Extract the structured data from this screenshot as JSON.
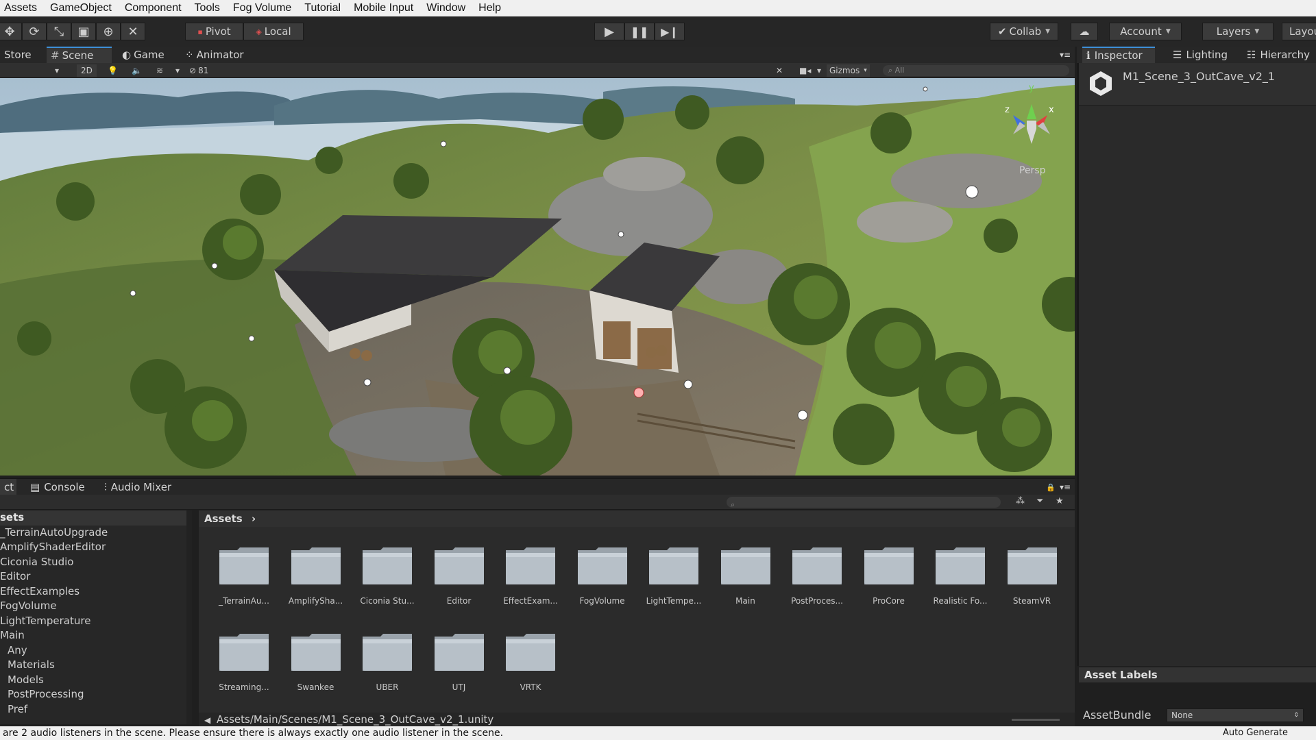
{
  "menu": [
    "Assets",
    "GameObject",
    "Component",
    "Tools",
    "Fog Volume",
    "Tutorial",
    "Mobile Input",
    "Window",
    "Help"
  ],
  "toolbar": {
    "pivot": "Pivot",
    "local": "Local",
    "collab": "Collab",
    "account": "Account",
    "layers": "Layers",
    "layout": "Layou"
  },
  "scene_tabs": {
    "store": "Store",
    "scene": "Scene",
    "game": "Game",
    "animator": "Animator"
  },
  "scene_bar": {
    "mode_2d": "2D",
    "hidden_count": "81",
    "gizmos": "Gizmos",
    "search_placeholder": "All"
  },
  "viewport": {
    "persp_label": "Persp",
    "gizmo_axes": [
      "y",
      "z",
      "x"
    ]
  },
  "inspector": {
    "tabs": [
      "Inspector",
      "Lighting",
      "Hierarchy"
    ],
    "object_name": "M1_Scene_3_OutCave_v2_1",
    "asset_labels": "Asset Labels",
    "assetbundle_label": "AssetBundle",
    "assetbundle_value": "None",
    "auto_generate": "Auto Generate Lightin"
  },
  "project": {
    "tabs": [
      "ct",
      "Console",
      "Audio Mixer"
    ],
    "tree_header": "sets",
    "tree": [
      "_TerrainAutoUpgrade",
      "AmplifyShaderEditor",
      "Ciconia Studio",
      "Editor",
      "EffectExamples",
      "FogVolume",
      "LightTemperature",
      "Main",
      "Any",
      "Materials",
      "Models",
      "PostProcessing",
      "Pref"
    ],
    "grid_header": "Assets",
    "folders": [
      "_TerrainAu...",
      "AmplifySha...",
      "Ciconia Stu...",
      "Editor",
      "EffectExam...",
      "FogVolume",
      "LightTempe...",
      "Main",
      "PostProces...",
      "ProCore",
      "Realistic Fo...",
      "SteamVR",
      "Streaming...",
      "Swankee",
      "UBER",
      "UTJ",
      "VRTK"
    ],
    "path": "Assets/Main/Scenes/M1_Scene_3_OutCave_v2_1.unity"
  },
  "status": {
    "message": "are 2 audio listeners in the scene. Please ensure there is always exactly one audio listener in the scene."
  },
  "colors": {
    "accent": "#3d8fd8",
    "panel": "#2a2a2a",
    "menubar": "#f0f0f0"
  }
}
